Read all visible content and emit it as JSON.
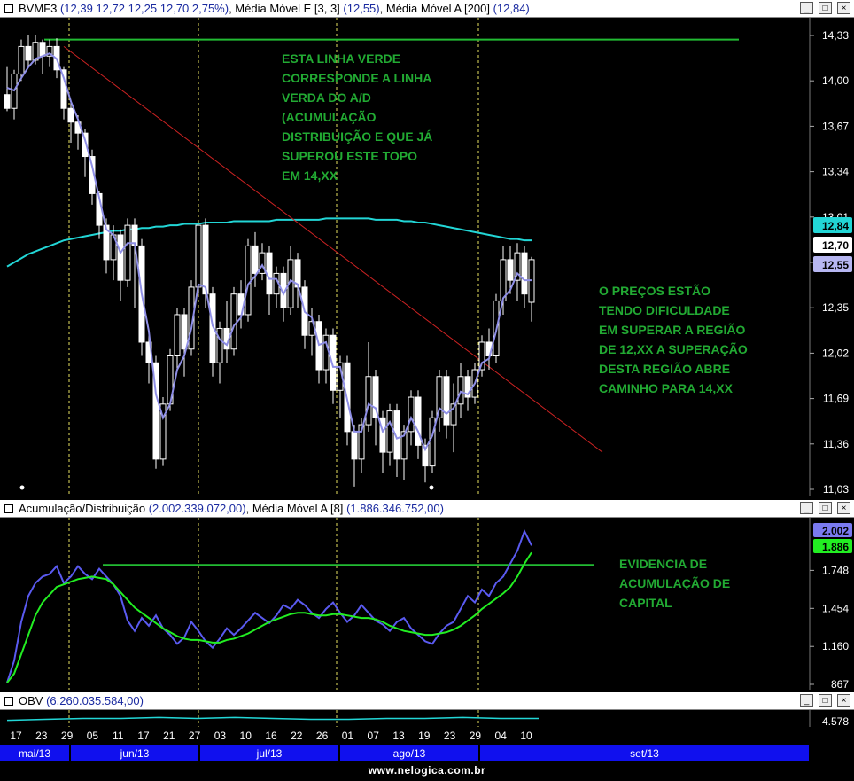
{
  "headers": {
    "price": {
      "symbol": "BVMF3",
      "ohlc": "(12,39  12,72  12,25  12,70  2,75%)",
      "ema_label": "Média Móvel E [3, 3]",
      "ema_value": "(12,55)",
      "sma_label": "Média Móvel A [200]",
      "sma_value": "(12,84)"
    },
    "ad": {
      "label": "Acumulação/Distribuição",
      "value": "(2.002.339.072,00)",
      "ma_label": "Média Móvel A [8]",
      "ma_value": "(1.886.346.752,00)"
    },
    "obv": {
      "label": "OBV",
      "value": "(6.260.035.584,00)"
    }
  },
  "window_buttons": {
    "minimize": "_",
    "restore": "□",
    "close": "×"
  },
  "annotations": {
    "green_line_note": "ESTA LINHA VERDE\nCORRESPONDE A LINHA\nVERDA DO A/D\n(ACUMULAÇÃO\nDISTRIBUIÇÃO E QUE JÁ\nSUPEROU ESTE TOPO\nEM 14,XX",
    "price_note": "O PREÇOS ESTÃO\nTENDO DIFICULDADE\nEM SUPERAR A REGIÃO\nDE 12,XX A SUPERAÇÃO\nDESTA REGIÃO ABRE\nCAMINHO PARA 14,XX",
    "ad_note": "EVIDENCIA DE\nACUMULAÇÃO DE\nCAPITAL"
  },
  "footer": "www.nelogica.com.br",
  "colors": {
    "background": "#000000",
    "candle": "#ffffff",
    "ema": "#8f8fe6",
    "sma200": "#22d6d6",
    "resistance": "#22bb33",
    "trendline": "#cc2222",
    "ad_line": "#5a5af0",
    "ad_ma": "#22ee22",
    "obv_line": "#22d6d6",
    "annotation": "#22aa33",
    "month_bar": "#1010ee"
  },
  "chart_data": [
    {
      "type": "candlestick",
      "title": "BVMF3",
      "ylim": [
        11.03,
        14.33
      ],
      "y_ticks": [
        "14,33",
        "14,00",
        "13,67",
        "13,34",
        "13,01",
        "12,68",
        "12,35",
        "12,02",
        "11,69",
        "11,36",
        "11,03"
      ],
      "value_badges": [
        {
          "label": "12,84",
          "value": 12.84,
          "series": "sma200"
        },
        {
          "label": "12,70",
          "value": 12.7,
          "series": "close"
        },
        {
          "label": "12,55",
          "value": 12.55,
          "series": "ema"
        }
      ],
      "candles": [
        [
          13.9,
          13.8,
          14.1,
          13.78
        ],
        [
          13.8,
          14.05,
          14.08,
          13.72
        ],
        [
          14.05,
          14.25,
          14.3,
          14.0
        ],
        [
          14.25,
          14.15,
          14.33,
          14.1
        ],
        [
          14.15,
          14.28,
          14.33,
          14.12
        ],
        [
          14.28,
          14.18,
          14.3,
          14.05
        ],
        [
          14.18,
          14.25,
          14.3,
          14.1
        ],
        [
          14.25,
          14.08,
          14.31,
          14.02
        ],
        [
          14.08,
          13.8,
          14.1,
          13.72
        ],
        [
          13.8,
          13.7,
          13.85,
          13.55
        ],
        [
          13.7,
          13.62,
          13.75,
          13.5
        ],
        [
          13.62,
          13.45,
          13.65,
          13.3
        ],
        [
          13.45,
          13.18,
          13.5,
          13.1
        ],
        [
          13.18,
          12.95,
          13.2,
          12.85
        ],
        [
          12.95,
          12.7,
          13.0,
          12.6
        ],
        [
          12.7,
          12.88,
          12.95,
          12.55
        ],
        [
          12.88,
          12.55,
          12.92,
          12.4
        ],
        [
          12.55,
          12.95,
          13.0,
          12.5
        ],
        [
          12.95,
          12.8,
          13.0,
          12.35
        ],
        [
          12.8,
          12.1,
          12.85,
          12.0
        ],
        [
          12.1,
          11.95,
          12.15,
          11.8
        ],
        [
          11.95,
          11.25,
          12.0,
          11.18
        ],
        [
          11.25,
          11.65,
          11.7,
          11.2
        ],
        [
          11.65,
          12.0,
          12.05,
          11.6
        ],
        [
          12.0,
          12.3,
          12.35,
          11.9
        ],
        [
          12.3,
          12.05,
          12.35,
          11.85
        ],
        [
          12.05,
          12.5,
          12.55,
          12.0
        ],
        [
          12.5,
          12.95,
          12.95,
          12.45
        ],
        [
          12.95,
          12.45,
          13.0,
          12.35
        ],
        [
          12.45,
          11.95,
          12.5,
          11.85
        ],
        [
          11.95,
          12.2,
          12.25,
          11.8
        ],
        [
          12.2,
          12.05,
          12.4,
          11.95
        ],
        [
          12.05,
          12.45,
          12.5,
          12.0
        ],
        [
          12.45,
          12.3,
          12.55,
          12.2
        ],
        [
          12.3,
          12.8,
          12.85,
          12.25
        ],
        [
          12.8,
          12.6,
          12.9,
          12.5
        ],
        [
          12.6,
          12.75,
          12.82,
          12.55
        ],
        [
          12.75,
          12.45,
          12.8,
          12.3
        ],
        [
          12.45,
          12.6,
          12.65,
          12.35
        ],
        [
          12.6,
          12.35,
          12.65,
          12.25
        ],
        [
          12.35,
          12.7,
          12.8,
          12.3
        ],
        [
          12.7,
          12.5,
          12.75,
          12.35
        ],
        [
          12.5,
          12.15,
          12.55,
          12.05
        ],
        [
          12.15,
          12.25,
          12.35,
          12.0
        ],
        [
          12.25,
          11.9,
          12.3,
          11.8
        ],
        [
          11.9,
          12.15,
          12.2,
          11.8
        ],
        [
          12.15,
          11.75,
          12.2,
          11.65
        ],
        [
          11.75,
          11.95,
          12.0,
          11.55
        ],
        [
          11.95,
          11.45,
          12.0,
          11.35
        ],
        [
          11.45,
          11.25,
          11.5,
          11.05
        ],
        [
          11.25,
          11.5,
          11.55,
          11.15
        ],
        [
          11.5,
          11.85,
          12.1,
          11.45
        ],
        [
          11.85,
          11.55,
          11.9,
          11.35
        ],
        [
          11.55,
          11.3,
          11.6,
          11.15
        ],
        [
          11.3,
          11.6,
          11.65,
          11.2
        ],
        [
          11.6,
          11.25,
          11.65,
          11.12
        ],
        [
          11.25,
          11.45,
          11.5,
          11.1
        ],
        [
          11.45,
          11.7,
          11.75,
          11.35
        ],
        [
          11.7,
          11.35,
          11.75,
          11.25
        ],
        [
          11.35,
          11.2,
          11.4,
          11.08
        ],
        [
          11.2,
          11.55,
          11.6,
          11.15
        ],
        [
          11.55,
          11.85,
          11.9,
          11.45
        ],
        [
          11.85,
          11.5,
          11.9,
          11.4
        ],
        [
          11.5,
          11.65,
          11.8,
          11.3
        ],
        [
          11.65,
          11.85,
          11.95,
          11.55
        ],
        [
          11.85,
          11.7,
          11.9,
          11.6
        ],
        [
          11.7,
          11.9,
          11.95,
          11.65
        ],
        [
          11.9,
          12.1,
          12.15,
          11.85
        ],
        [
          12.1,
          12.0,
          12.2,
          11.9
        ],
        [
          12.0,
          12.4,
          12.45,
          11.95
        ],
        [
          12.4,
          12.7,
          12.8,
          12.3
        ],
        [
          12.7,
          12.55,
          12.8,
          12.45
        ],
        [
          12.55,
          12.75,
          12.82,
          12.4
        ],
        [
          12.75,
          12.45,
          12.8,
          12.35
        ],
        [
          12.39,
          12.7,
          12.72,
          12.25
        ]
      ],
      "ema": [
        13.95,
        13.93,
        14.02,
        14.1,
        14.16,
        14.18,
        14.2,
        14.16,
        14.02,
        13.85,
        13.72,
        13.57,
        13.38,
        13.15,
        12.92,
        12.88,
        12.75,
        12.82,
        12.82,
        12.45,
        12.18,
        11.72,
        11.55,
        11.65,
        11.9,
        12.0,
        12.2,
        12.52,
        12.5,
        12.22,
        12.12,
        12.08,
        12.22,
        12.28,
        12.52,
        12.58,
        12.66,
        12.56,
        12.56,
        12.45,
        12.55,
        12.52,
        12.32,
        12.28,
        12.08,
        12.1,
        11.92,
        11.92,
        11.68,
        11.45,
        11.45,
        11.65,
        11.62,
        11.45,
        11.52,
        11.4,
        11.42,
        11.55,
        11.45,
        11.32,
        11.42,
        11.62,
        11.58,
        11.62,
        11.74,
        11.72,
        11.8,
        11.95,
        11.98,
        12.18,
        12.42,
        12.48,
        12.6,
        12.55,
        12.55
      ],
      "sma200": [
        12.65,
        12.68,
        12.71,
        12.74,
        12.76,
        12.78,
        12.8,
        12.82,
        12.84,
        12.85,
        12.86,
        12.87,
        12.88,
        12.89,
        12.9,
        12.91,
        12.91,
        12.92,
        12.92,
        12.93,
        12.93,
        12.94,
        12.94,
        12.95,
        12.95,
        12.96,
        12.96,
        12.96,
        12.97,
        12.97,
        12.97,
        12.97,
        12.98,
        12.98,
        12.98,
        12.98,
        12.98,
        12.98,
        12.99,
        12.99,
        12.99,
        12.99,
        12.99,
        12.99,
        12.99,
        13.0,
        13.0,
        13.0,
        13.0,
        13.0,
        13.0,
        13.0,
        12.99,
        12.99,
        12.99,
        12.99,
        12.98,
        12.98,
        12.97,
        12.97,
        12.96,
        12.95,
        12.94,
        12.93,
        12.92,
        12.91,
        12.9,
        12.89,
        12.88,
        12.87,
        12.86,
        12.85,
        12.85,
        12.84,
        12.84
      ],
      "resistance_level": 14.3,
      "trendline": [
        [
          8,
          14.25
        ],
        [
          84,
          11.3
        ]
      ]
    },
    {
      "type": "line",
      "title": "Acumulação/Distribuição",
      "ylim": [
        867,
        2100
      ],
      "y_ticks": [
        "1.748",
        "1.454",
        "1.160",
        "867"
      ],
      "value_badges": [
        {
          "label": "2.002",
          "value": 2002,
          "series": "ad"
        },
        {
          "label": "1.886",
          "value": 1886,
          "series": "ma"
        }
      ],
      "series": [
        {
          "name": "Acumulação/Distribuição",
          "values": [
            880,
            1050,
            1350,
            1550,
            1650,
            1700,
            1720,
            1780,
            1650,
            1700,
            1780,
            1720,
            1680,
            1760,
            1700,
            1640,
            1550,
            1360,
            1280,
            1380,
            1320,
            1400,
            1300,
            1250,
            1180,
            1230,
            1350,
            1280,
            1200,
            1150,
            1220,
            1300,
            1250,
            1300,
            1360,
            1420,
            1380,
            1340,
            1400,
            1480,
            1450,
            1520,
            1480,
            1420,
            1380,
            1450,
            1500,
            1420,
            1350,
            1400,
            1480,
            1420,
            1360,
            1330,
            1280,
            1350,
            1380,
            1300,
            1250,
            1200,
            1180,
            1260,
            1320,
            1350,
            1450,
            1550,
            1500,
            1600,
            1550,
            1650,
            1700,
            1800,
            1900,
            2050,
            1940
          ]
        },
        {
          "name": "Média Móvel A [8]",
          "values": [
            880,
            950,
            1100,
            1250,
            1400,
            1500,
            1560,
            1620,
            1640,
            1660,
            1680,
            1690,
            1700,
            1690,
            1680,
            1640,
            1580,
            1520,
            1460,
            1420,
            1380,
            1340,
            1300,
            1270,
            1240,
            1220,
            1210,
            1210,
            1200,
            1190,
            1190,
            1210,
            1220,
            1240,
            1260,
            1290,
            1320,
            1350,
            1370,
            1390,
            1410,
            1420,
            1420,
            1410,
            1400,
            1400,
            1410,
            1410,
            1400,
            1390,
            1380,
            1380,
            1370,
            1350,
            1320,
            1300,
            1280,
            1270,
            1260,
            1250,
            1250,
            1260,
            1270,
            1290,
            1320,
            1360,
            1400,
            1450,
            1490,
            1530,
            1570,
            1620,
            1700,
            1800,
            1886
          ]
        }
      ],
      "resistance_level": 1790,
      "resistance_span": [
        27,
        156
      ]
    },
    {
      "type": "line",
      "title": "OBV",
      "y_ticks": [
        "4.578"
      ],
      "series": [
        {
          "name": "OBV",
          "values": [
            4.6,
            4.61,
            4.62,
            4.62,
            4.63,
            4.62,
            4.63,
            4.62,
            4.61,
            4.61,
            4.62,
            4.62,
            4.63,
            4.62,
            4.62
          ]
        }
      ]
    }
  ],
  "time_axis": {
    "day_labels": [
      "17",
      "23",
      "29",
      "05",
      "11",
      "17",
      "21",
      "27",
      "03",
      "10",
      "16",
      "22",
      "26",
      "01",
      "07",
      "13",
      "19",
      "23",
      "29",
      "04",
      "10"
    ],
    "months": [
      {
        "label": "mai/13",
        "start": 0,
        "end": 3
      },
      {
        "label": "jun/13",
        "start": 3,
        "end": 8
      },
      {
        "label": "jul/13",
        "start": 8,
        "end": 13
      },
      {
        "label": "ago/13",
        "start": 13,
        "end": 18
      },
      {
        "label": "set/13",
        "start": 18,
        "end": 30
      }
    ],
    "vline_ticks": [
      2,
      7,
      13,
      18
    ]
  }
}
